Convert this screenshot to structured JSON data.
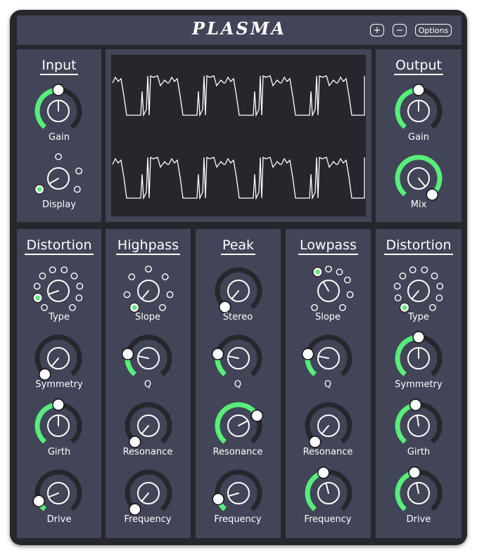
{
  "header": {
    "title": "PLASMA",
    "plus_label": "+",
    "minus_label": "−",
    "options_label": "Options"
  },
  "colors": {
    "accent": "#57ee7a",
    "panel": "#424457",
    "frame": "#26272d",
    "track": "#26272d"
  },
  "input": {
    "title": "Input",
    "gain_label": "Gain",
    "display_label": "Display"
  },
  "output": {
    "title": "Output",
    "gain_label": "Gain",
    "mix_label": "Mix"
  },
  "distortion1": {
    "title": "Distortion",
    "type_label": "Type",
    "symmetry_label": "Symmetry",
    "girth_label": "Girth",
    "drive_label": "Drive"
  },
  "highpass": {
    "title": "Highpass",
    "slope_label": "Slope",
    "q_label": "Q",
    "resonance_label": "Resonance",
    "frequency_label": "Frequency"
  },
  "peak": {
    "title": "Peak",
    "stereo_label": "Stereo",
    "q_label": "Q",
    "resonance_label": "Resonance",
    "frequency_label": "Frequency"
  },
  "lowpass": {
    "title": "Lowpass",
    "slope_label": "Slope",
    "q_label": "Q",
    "resonance_label": "Resonance",
    "frequency_label": "Frequency"
  },
  "distortion2": {
    "title": "Distortion",
    "type_label": "Type",
    "symmetry_label": "Symmetry",
    "girth_label": "Girth",
    "drive_label": "Drive"
  },
  "knob_values": {
    "input_gain": 0.5,
    "output_gain": 0.5,
    "output_mix": 1.0,
    "d1_symmetry": 0.0,
    "d1_girth": 0.5,
    "d1_drive": 0.1,
    "hp_q": 0.22,
    "hp_resonance": 0.0,
    "hp_frequency": 0.0,
    "peak_stereo": 0.0,
    "peak_q": 0.22,
    "peak_resonance": 0.72,
    "peak_frequency": 0.12,
    "lp_q": 0.22,
    "lp_resonance": 0.0,
    "lp_frequency": 0.45,
    "d2_symmetry": 0.5,
    "d2_girth": 0.47,
    "d2_drive": 0.46
  },
  "stepped_values": {
    "input_display_selected": 0,
    "d1_type_selected": 1,
    "hp_slope_selected": 0,
    "lp_slope_selected": 1,
    "d2_type_selected": 0
  }
}
